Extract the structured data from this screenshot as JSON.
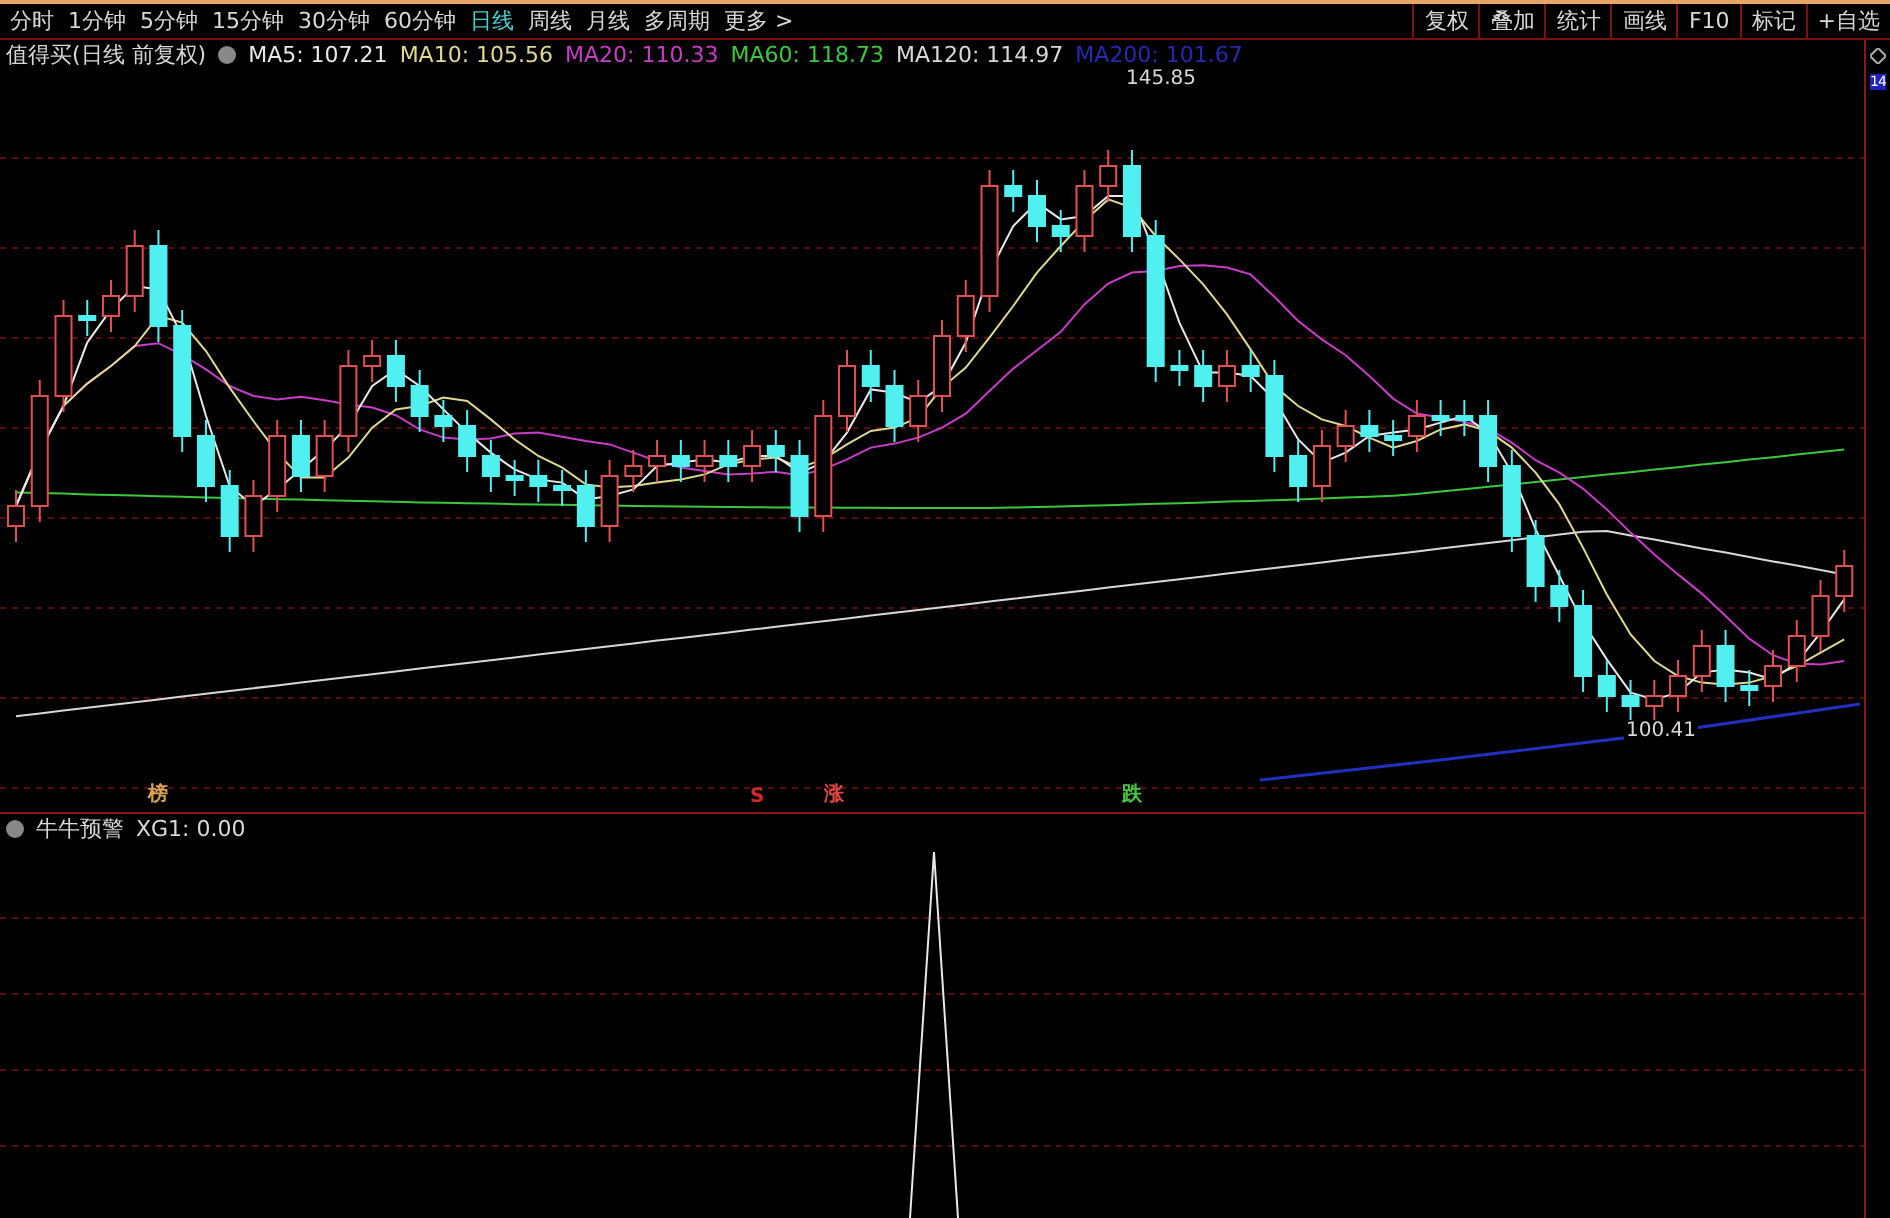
{
  "toolbar": {
    "periods": [
      {
        "label": "分时",
        "selected": false
      },
      {
        "label": "1分钟",
        "selected": false
      },
      {
        "label": "5分钟",
        "selected": false
      },
      {
        "label": "15分钟",
        "selected": false
      },
      {
        "label": "30分钟",
        "selected": false
      },
      {
        "label": "60分钟",
        "selected": false
      },
      {
        "label": "日线",
        "selected": true
      },
      {
        "label": "周线",
        "selected": false
      },
      {
        "label": "月线",
        "selected": false
      },
      {
        "label": "多周期",
        "selected": false
      },
      {
        "label": "更多 >",
        "selected": false
      }
    ],
    "tools": [
      "复权",
      "叠加",
      "统计",
      "画线",
      "F10",
      "标记",
      "+自选"
    ]
  },
  "main_chart": {
    "title": "值得买(日线 前复权)",
    "indicators": [
      {
        "label": "MA5: 107.21",
        "color": "#e8e8e8"
      },
      {
        "label": "MA10: 105.56",
        "color": "#e0d890"
      },
      {
        "label": "MA20: 110.33",
        "color": "#c83cc8"
      },
      {
        "label": "MA60: 118.73",
        "color": "#3cc83c"
      },
      {
        "label": "MA120: 114.97",
        "color": "#d8d8d8"
      },
      {
        "label": "MA200: 101.67",
        "color": "#2828b0"
      }
    ],
    "high_label": "145.85",
    "low_label": "100.41",
    "axis_label": "14",
    "signals": [
      {
        "text": "榜",
        "color": "#d8a050"
      },
      {
        "text": "S",
        "color": "#d02828"
      },
      {
        "text": "涨",
        "color": "#e04848"
      },
      {
        "text": "跌",
        "color": "#48c848"
      }
    ]
  },
  "indicator_panel": {
    "title": "牛牛预警",
    "reading": "XG1: 0.00"
  }
}
